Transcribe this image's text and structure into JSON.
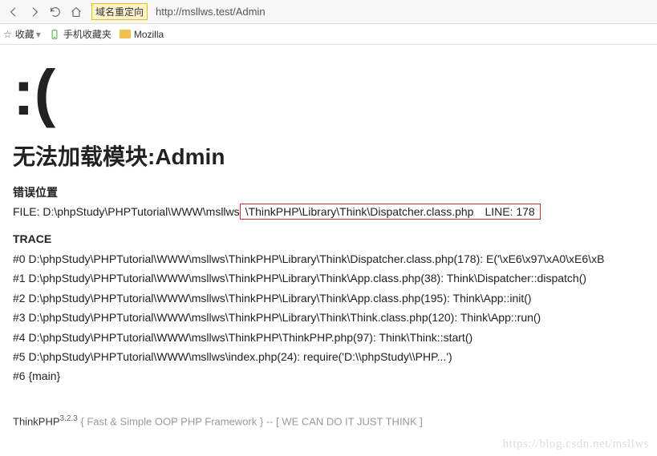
{
  "browser": {
    "badge": "域名重定向",
    "url": "http://msllws.test/Admin",
    "favorites_label": "收藏",
    "bookmark_mobile": "手机收藏夹",
    "bookmark_mozilla": "Mozilla"
  },
  "error": {
    "face": ":(",
    "title": "无法加载模块:Admin",
    "location_label": "错误位置",
    "file_prefix": "FILE: D:\\phpStudy\\PHPTutorial\\WWW\\msllws",
    "file_highlight": "\\ThinkPHP\\Library\\Think\\Dispatcher.class.php LINE: 178",
    "trace_label": "TRACE",
    "trace": [
      "#0 D:\\phpStudy\\PHPTutorial\\WWW\\msllws\\ThinkPHP\\Library\\Think\\Dispatcher.class.php(178): E('\\xE6\\x97\\xA0\\xE6\\xB",
      "#1 D:\\phpStudy\\PHPTutorial\\WWW\\msllws\\ThinkPHP\\Library\\Think\\App.class.php(38): Think\\Dispatcher::dispatch()",
      "#2 D:\\phpStudy\\PHPTutorial\\WWW\\msllws\\ThinkPHP\\Library\\Think\\App.class.php(195): Think\\App::init()",
      "#3 D:\\phpStudy\\PHPTutorial\\WWW\\msllws\\ThinkPHP\\Library\\Think\\Think.class.php(120): Think\\App::run()",
      "#4 D:\\phpStudy\\PHPTutorial\\WWW\\msllws\\ThinkPHP\\ThinkPHP.php(97): Think\\Think::start()",
      "#5 D:\\phpStudy\\PHPTutorial\\WWW\\msllws\\index.php(24): require('D:\\\\phpStudy\\\\PHP...')",
      "#6 {main}"
    ]
  },
  "footer": {
    "name": "ThinkPHP",
    "version": "3.2.3",
    "slogan": " { Fast & Simple OOP PHP Framework } -- [ WE CAN DO IT JUST THINK ]"
  },
  "watermark": "https://blog.csdn.net/msllws"
}
